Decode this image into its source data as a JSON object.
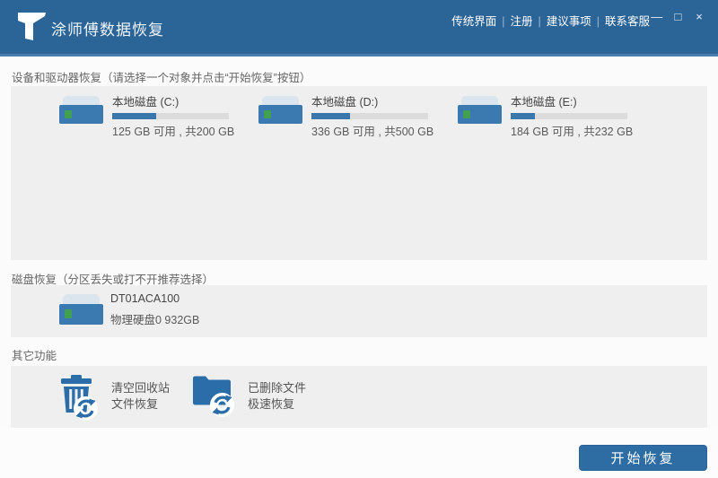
{
  "window": {
    "title": "涂师傅数据恢复",
    "nav_separator": "|",
    "nav_links": [
      {
        "label": "传统界面"
      },
      {
        "label": "注册"
      },
      {
        "label": "建议事项"
      },
      {
        "label": "联系客服"
      }
    ],
    "controls": {
      "minimize": "—",
      "maximize": "□",
      "close": "×"
    }
  },
  "colors": {
    "header_blue": "#2b6496",
    "header_strip": "#4a7dab",
    "accent_blue": "#2e6da4",
    "icon_blue": "#2a6da8",
    "disk_body_blue": "#3b79b1",
    "disk_lid": "#dbe5ee",
    "led_green": "#42a052",
    "bar_fill": "#3a77ad",
    "bar_bg": "#dcdcdc",
    "panel_gray": "#efefef"
  },
  "sections": {
    "drives": {
      "title": "设备和驱动器恢复（请选择一个对象并点击“开始恢复”按钮）",
      "items": [
        {
          "name": "本地磁盘  (C:)",
          "detail": "125 GB 可用 , 共200 GB",
          "used_percent": 37.5
        },
        {
          "name": "本地磁盘  (D:)",
          "detail": "336 GB 可用 , 共500 GB",
          "used_percent": 32.8
        },
        {
          "name": "本地磁盘  (E:)",
          "detail": "184 GB 可用 , 共232 GB",
          "used_percent": 20.7
        }
      ]
    },
    "disk": {
      "title": "磁盘恢复（分区丢失或打不开推荐选择）",
      "items": [
        {
          "name": "DT01ACA100",
          "detail": "物理硬盘0 932GB"
        }
      ]
    },
    "other": {
      "title": "其它功能",
      "items": [
        {
          "line1": "清空回收站",
          "line2": "文件恢复"
        },
        {
          "line1": "已删除文件",
          "line2": "极速恢复"
        }
      ]
    }
  },
  "footer": {
    "start_button": "开始恢复"
  }
}
